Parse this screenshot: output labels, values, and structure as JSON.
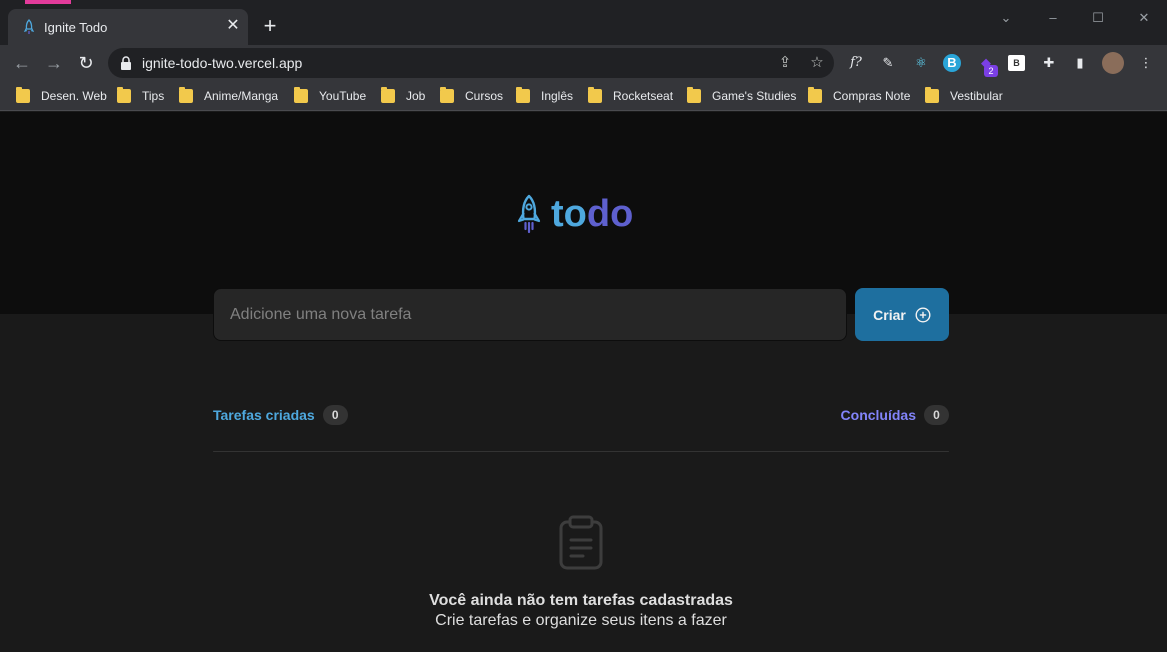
{
  "browser": {
    "tab_title": "Ignite Todo",
    "tab_close": "✕",
    "new_tab": "+",
    "url": "ignite-todo-two.vercel.app",
    "bookmarks": [
      {
        "label": "Desen. Web"
      },
      {
        "label": "Tips"
      },
      {
        "label": "Anime/Manga"
      },
      {
        "label": "YouTube"
      },
      {
        "label": "Job"
      },
      {
        "label": "Cursos"
      },
      {
        "label": "Inglês"
      },
      {
        "label": "Rocketseat"
      },
      {
        "label": "Game's Studies"
      },
      {
        "label": "Compras Note"
      },
      {
        "label": "Vestibular"
      }
    ],
    "extension_badge": "2",
    "extension_b_label": "B",
    "extension_f_label": "f?"
  },
  "app": {
    "logo_part1": "to",
    "logo_part2": "do",
    "input_placeholder": "Adicione uma nova tarefa",
    "create_label": "Criar",
    "created_label": "Tarefas criadas",
    "created_count": "0",
    "done_label": "Concluídas",
    "done_count": "0",
    "empty_title": "Você ainda não tem tarefas cadastradas",
    "empty_subtitle": "Crie tarefas e organize seus itens a fazer"
  },
  "colors": {
    "blue": "#4ea8de",
    "purple": "#8284fa",
    "button": "#1e6f9f"
  }
}
